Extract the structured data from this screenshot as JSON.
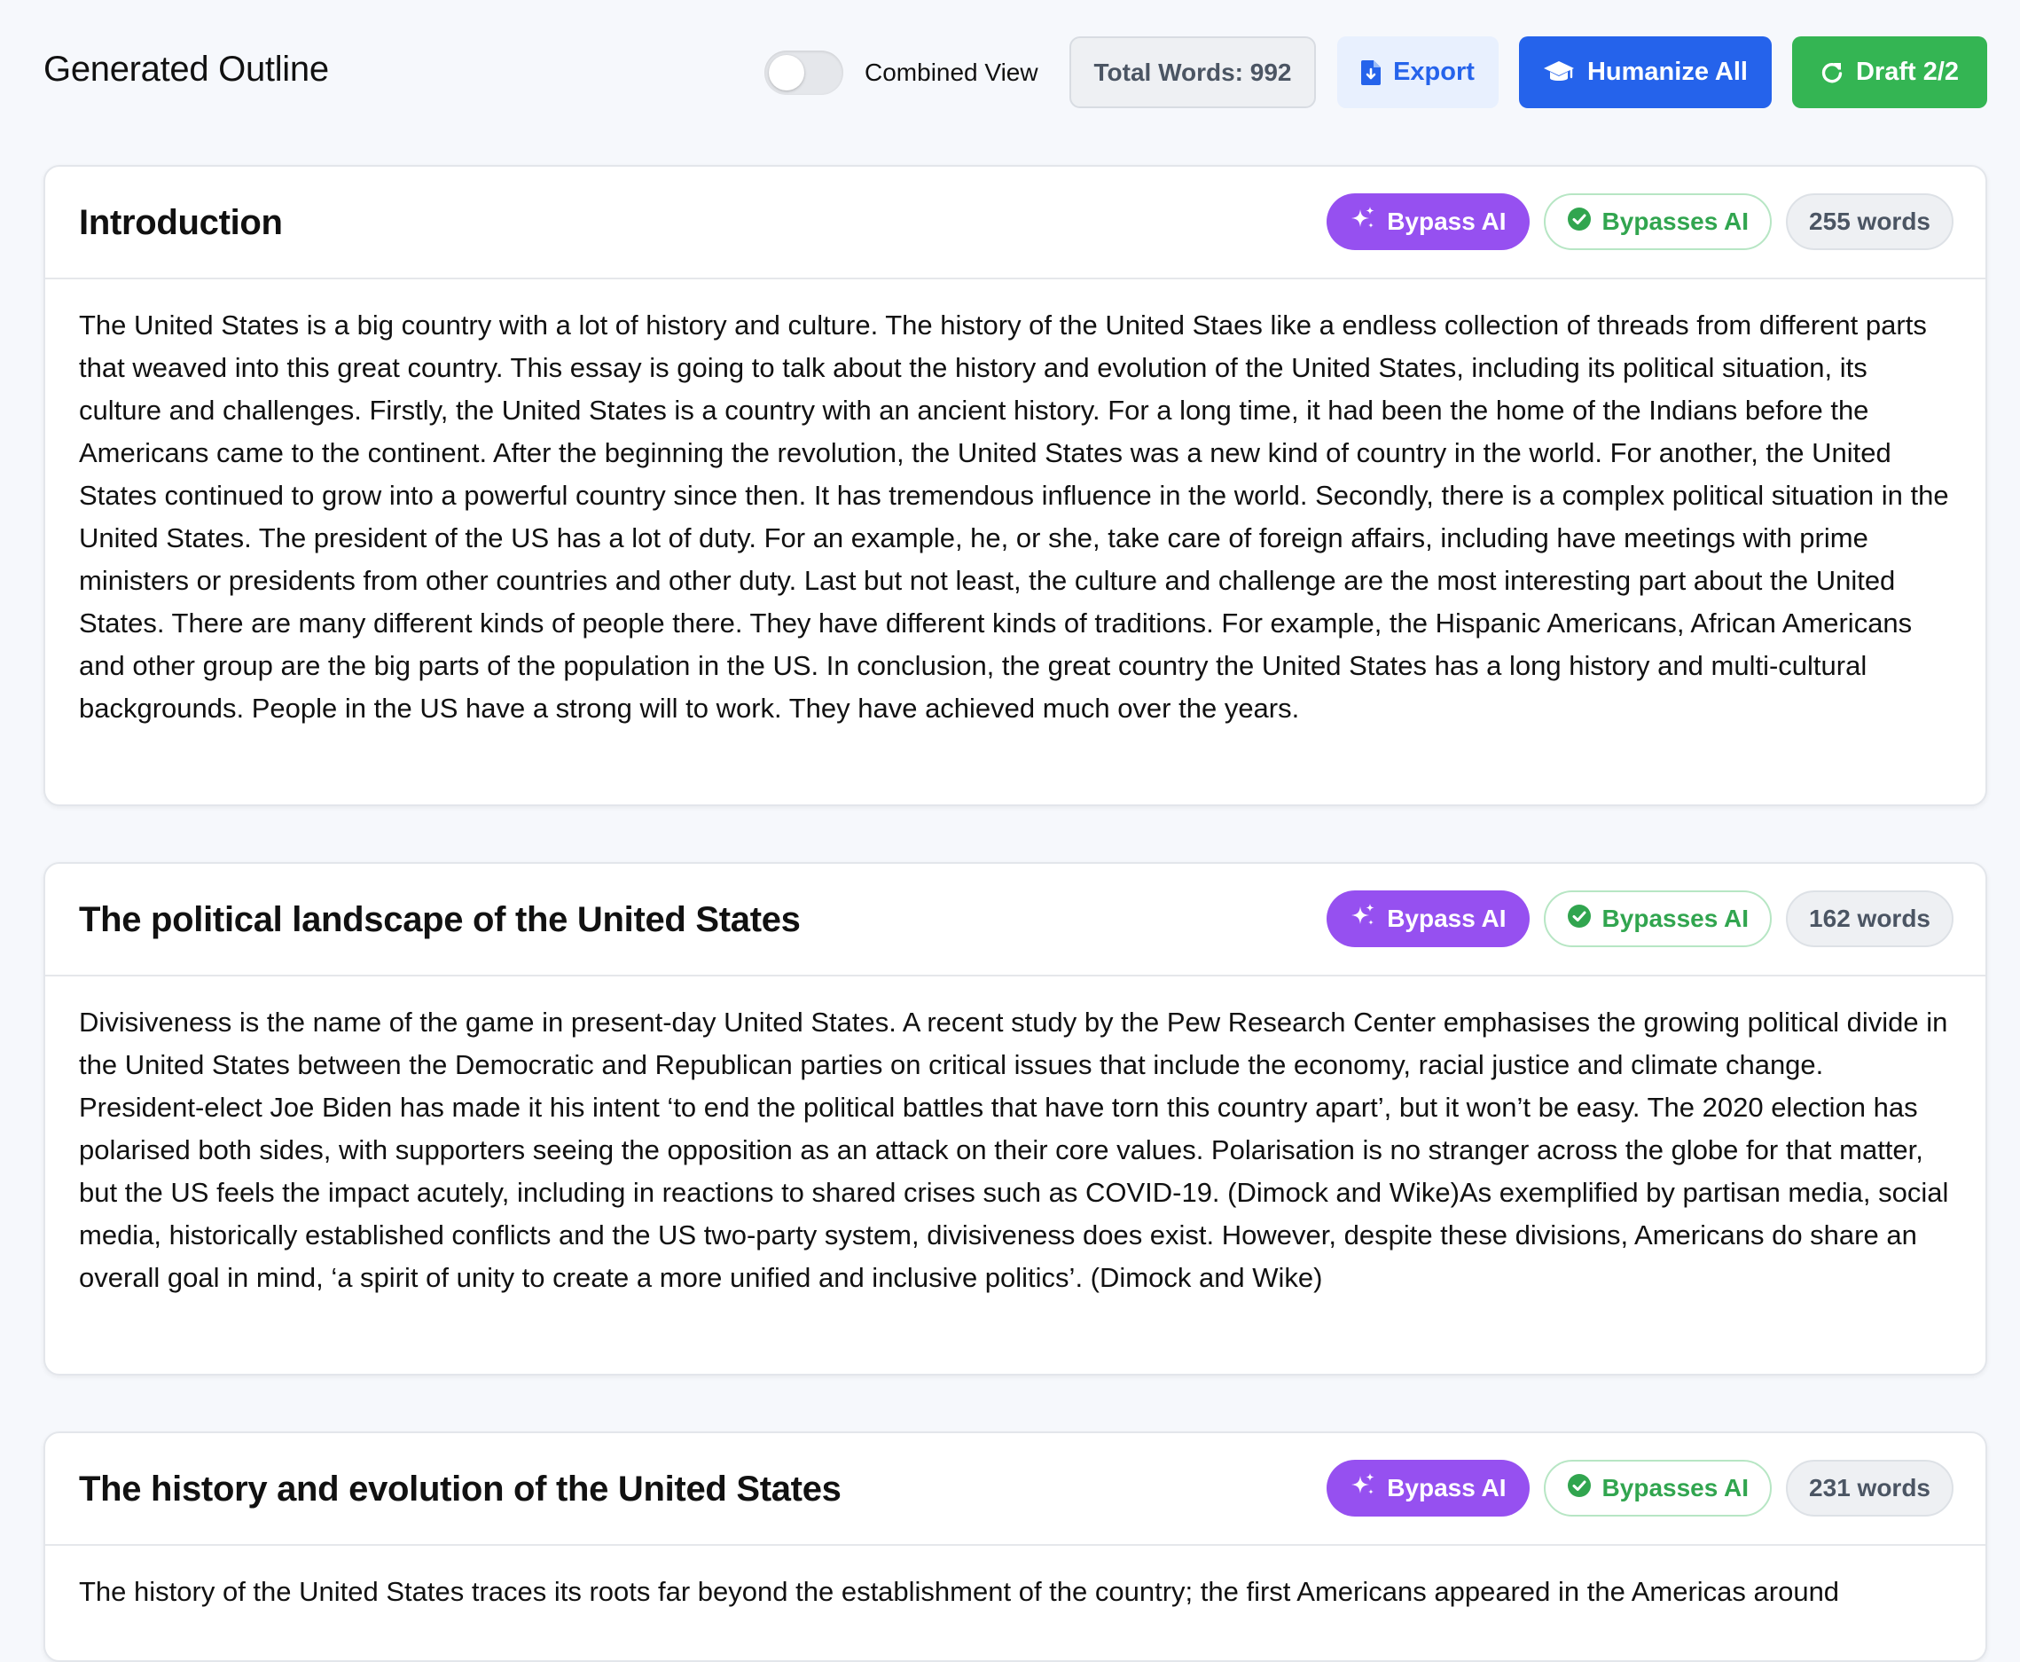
{
  "header": {
    "title": "Generated Outline",
    "combined_view_label": "Combined View",
    "combined_view_on": false,
    "total_words": "Total Words: 992",
    "export_label": "Export",
    "humanize_label": "Humanize All",
    "draft_label": "Draft 2/2"
  },
  "colors": {
    "primary_blue": "#2563eb",
    "purple": "#9650f0",
    "green": "#34b553"
  },
  "sections": [
    {
      "title": "Introduction",
      "bypass_label": "Bypass AI",
      "status_label": "Bypasses AI",
      "word_count": "255 words",
      "body": "The United States is a big country with a lot of history and culture. The history of the United Staes like a endless collection of threads from different parts that weaved into this great country. This essay is going to talk about the history and evolution of the United States, including its political situation, its culture and challenges. Firstly, the United States is a country with an ancient history. For a long time, it had been the home of the Indians before the Americans came to the continent. After the beginning the revolution, the United States was a new kind of country in the world. For another, the United States continued to grow into a powerful country since then. It has tremendous influence in the world. Secondly, there is a complex political situation in the United States. The president of the US has a lot of duty. For an example, he, or she, take care of foreign affairs, including have meetings with prime ministers or presidents from other countries and other duty. Last but not least, the culture and challenge are the most interesting part about the United States. There are many different kinds of people there. They have different kinds of traditions. For example, the Hispanic Americans, African Americans and other group are the big parts of the population in the US. In conclusion, the great country the United States has a long history and multi-cultural backgrounds. People in the US have a strong will to work. They have achieved much over the years."
    },
    {
      "title": "The political landscape of the United States",
      "bypass_label": "Bypass AI",
      "status_label": "Bypasses AI",
      "word_count": "162 words",
      "body": "Divisiveness is the name of the game in present-day United States. A recent study by the Pew Research Center emphasises the growing political divide in the United States between the Democratic and Republican parties on critical issues that include the economy, racial justice and climate change. President-elect Joe Biden has made it his intent ‘to end the political battles that have torn this country apart’, but it won’t be easy. The 2020 election has polarised both sides, with supporters seeing the opposition as an attack on their core values. Polarisation is no stranger across the globe for that matter, but the US feels the impact acutely, including in reactions to shared crises such as COVID-19. (Dimock and Wike)As exemplified by partisan media, social media, historically established conflicts and the US two-party system, divisiveness does exist. However, despite these divisions, Americans do share an overall goal in mind, ‘a spirit of unity to create a more unified and inclusive politics’. (Dimock and Wike)"
    },
    {
      "title": "The history and evolution of the United States",
      "bypass_label": "Bypass AI",
      "status_label": "Bypasses AI",
      "word_count": "231 words",
      "body": "The history of the United States traces its roots far beyond the establishment of the country; the first Americans appeared in the Americas around"
    }
  ]
}
